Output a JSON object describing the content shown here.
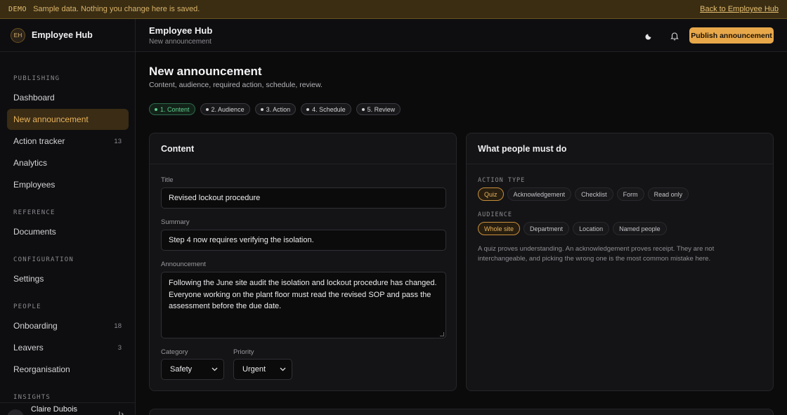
{
  "banner": {
    "tag": "DEMO",
    "message": "Sample data. Nothing you change here is saved.",
    "back_link": "Back to Employee Hub"
  },
  "sidebar": {
    "brand_initials": "EH",
    "brand_name": "Employee Hub",
    "sections": [
      {
        "label": "PUBLISHING",
        "items": [
          {
            "label": "Dashboard"
          },
          {
            "label": "New announcement",
            "active": true
          },
          {
            "label": "Action tracker",
            "count": "13"
          },
          {
            "label": "Analytics"
          },
          {
            "label": "Employees"
          }
        ]
      },
      {
        "label": "REFERENCE",
        "items": [
          {
            "label": "Documents"
          }
        ]
      },
      {
        "label": "CONFIGURATION",
        "items": [
          {
            "label": "Settings"
          }
        ]
      },
      {
        "label": "PEOPLE",
        "items": [
          {
            "label": "Onboarding",
            "count": "18"
          },
          {
            "label": "Leavers",
            "count": "3"
          },
          {
            "label": "Reorganisation"
          }
        ]
      },
      {
        "label": "INSIGHTS"
      }
    ],
    "user": {
      "initials": "CD",
      "name": "Claire Dubois"
    }
  },
  "header": {
    "title": "Employee Hub",
    "subtitle": "New announcement",
    "publish_label": "Publish announcement",
    "theme_icon": "moon-icon",
    "notifications_icon": "bell-icon"
  },
  "page": {
    "title": "New announcement",
    "subtitle": "Content, audience, required action, schedule, review.",
    "steps": [
      "1. Content",
      "2. Audience",
      "3. Action",
      "4. Schedule",
      "5. Review"
    ],
    "active_step": 0
  },
  "content_card": {
    "heading": "Content",
    "title_label": "Title",
    "title_value": "Revised lockout procedure",
    "summary_label": "Summary",
    "summary_value": "Step 4 now requires verifying the isolation.",
    "announcement_label": "Announcement",
    "announcement_value": "Following the June site audit the isolation and lockout procedure has changed. Everyone working on the plant floor must read the revised SOP and pass the assessment before the due date.",
    "category_label": "Category",
    "category_value": "Safety",
    "priority_label": "Priority",
    "priority_value": "Urgent"
  },
  "action_card": {
    "heading": "What people must do",
    "action_type_label": "ACTION TYPE",
    "action_types": [
      "Quiz",
      "Acknowledgement",
      "Checklist",
      "Form",
      "Read only"
    ],
    "action_type_selected": "Quiz",
    "audience_label": "AUDIENCE",
    "audiences": [
      "Whole site",
      "Department",
      "Location",
      "Named people"
    ],
    "audience_selected": "Whole site",
    "hint": "A quiz proves understanding. An acknowledgement proves receipt. They are not interchangeable, and picking the wrong one is the most common mistake here."
  },
  "colors": {
    "accent": "#e8a84a",
    "banner_bg": "#3a2d12",
    "active_step": "#5fcf8e",
    "background": "#0b0b0c"
  }
}
